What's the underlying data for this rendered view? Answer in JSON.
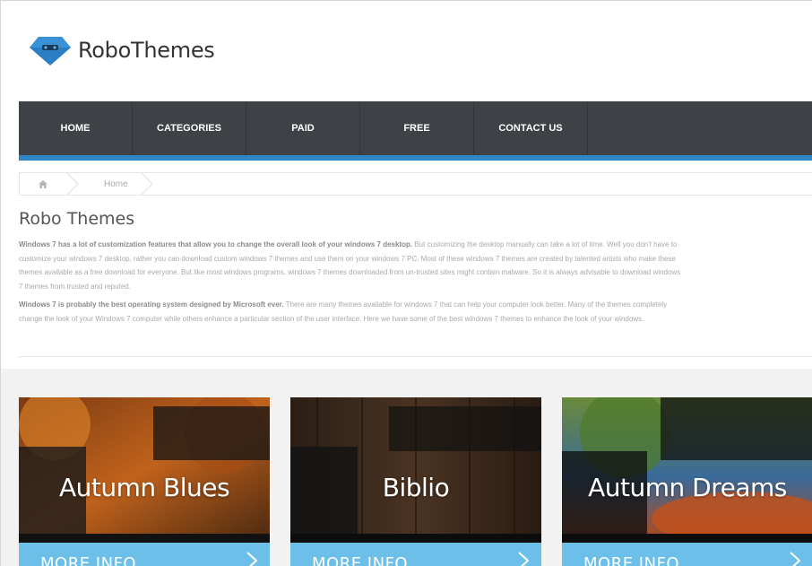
{
  "site": {
    "name": "RoboThemes"
  },
  "nav": {
    "items": [
      "HOME",
      "CATEGORIES",
      "PAID",
      "FREE",
      "CONTACT US"
    ]
  },
  "breadcrumb": {
    "current": "Home"
  },
  "main": {
    "title": "Robo Themes",
    "para1_bold": "Windows 7 has a lot of customization features that allow you to change the overall look of your windows 7 desktop.",
    "para1_rest": " But customizing the desktop manually can take a lot of time. Well you don't have to customize your windows 7 desktop, rather you can download custom windows 7 themes and use them on your windows 7 PC. Most of these windows 7 themes are created by talented artists who make these themes available as a free download for everyone. But like most windows programs, windows 7 themes downloaded from un-trusted sites might contain malware. So it is always advisable to download windows 7 themes from trusted and reputed.",
    "para2_bold": "Windows 7 is probably the best operating system designed by Microsoft ever.",
    "para2_rest": " There are many themes available for windows 7 that can help your computer look better. Many of the themes completely change the look of your Windows 7 computer while others enhance a particular section of the user interface. Here we have some of the best windows 7 themes to enhance the look of your windows."
  },
  "cards": [
    {
      "title": "Autumn Blues",
      "more": "MORE INFO"
    },
    {
      "title": "Biblio",
      "more": "MORE INFO"
    },
    {
      "title": "Autumn Dreams",
      "more": "MORE INFO"
    }
  ],
  "colors": {
    "nav": "#3e4247",
    "accent": "#2f86c6",
    "logo": "#2b7ec4",
    "more": "#6bbfe9"
  }
}
